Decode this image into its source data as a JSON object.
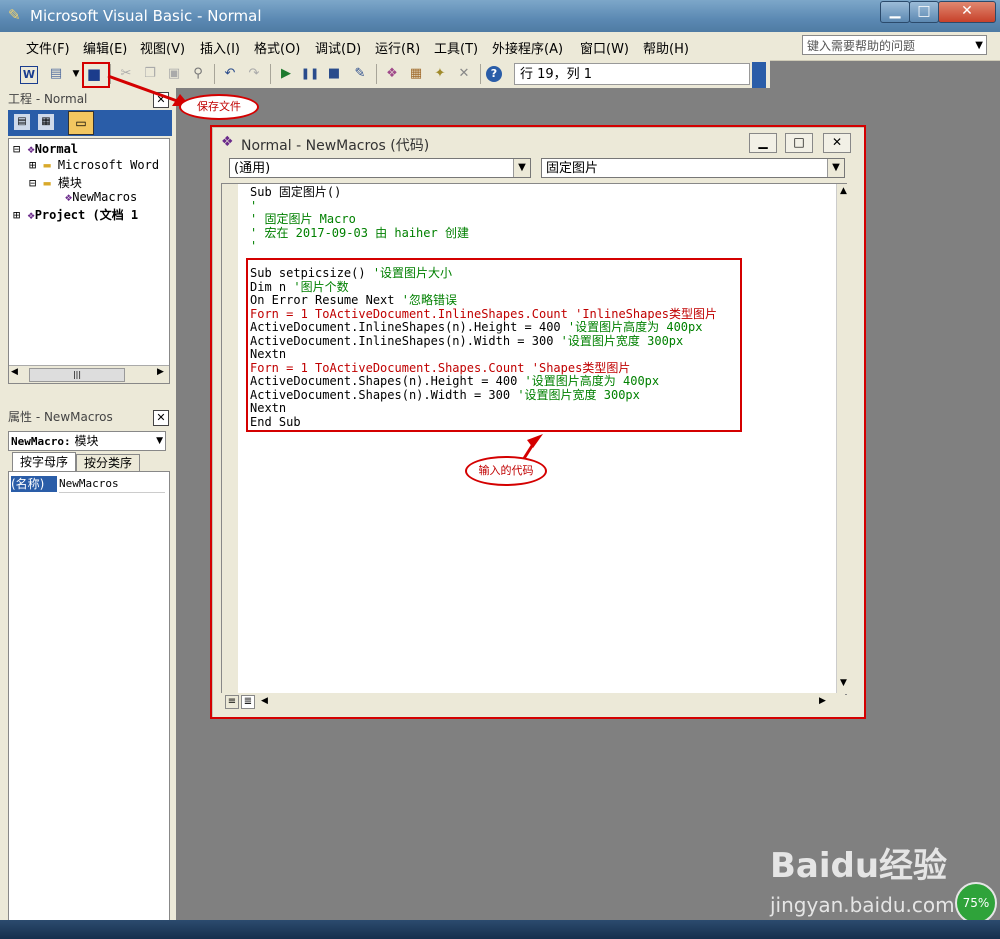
{
  "window": {
    "title": "Microsoft Visual Basic - Normal",
    "minimize": "▁",
    "restore": "□",
    "close": "✕"
  },
  "menu": [
    "文件(F)",
    "编辑(E)",
    "视图(V)",
    "插入(I)",
    "格式(O)",
    "调试(D)",
    "运行(R)",
    "工具(T)",
    "外接程序(A)",
    "窗口(W)",
    "帮助(H)"
  ],
  "help_search": {
    "placeholder": "键入需要帮助的问题"
  },
  "toolbar": {
    "position": "行 19，列 1"
  },
  "project_panel": {
    "title": "工程 - Normal",
    "tree": [
      "Normal",
      "Microsoft Word",
      "模块",
      "NewMacros",
      "Project (文档 1"
    ]
  },
  "properties_panel": {
    "title": "属性 - NewMacros",
    "object_name": "NewMacro:",
    "object_type": "模块",
    "tabs": [
      "按字母序",
      "按分类序"
    ],
    "row_key": "(名称)",
    "row_value": "NewMacros"
  },
  "code_window": {
    "title": "Normal - NewMacros (代码)",
    "object_combo": "(通用)",
    "proc_combo": "固定图片",
    "lines": [
      {
        "t": "Sub 固定图片()",
        "c": "k"
      },
      {
        "t": "'",
        "c": "g"
      },
      {
        "t": "' 固定图片 Macro",
        "c": "g"
      },
      {
        "t": "' 宏在 2017-09-03 由 haiher 创建",
        "c": "g"
      },
      {
        "t": "'",
        "c": "g"
      },
      {
        "t": "",
        "c": "k"
      },
      {
        "t": "Sub setpicsize() '设置图片大小",
        "c": "k"
      },
      {
        "t": "Dim n '图片个数",
        "c": "k"
      },
      {
        "t": "On Error Resume Next '忽略错误",
        "c": "k"
      },
      {
        "t": "Forn = 1 ToActiveDocument.InlineShapes.Count 'InlineShapes类型图片",
        "c": "r"
      },
      {
        "t": "ActiveDocument.InlineShapes(n).Height = 400 '设置图片高度为 400px",
        "c": "k"
      },
      {
        "t": "ActiveDocument.InlineShapes(n).Width = 300 '设置图片宽度 300px",
        "c": "k"
      },
      {
        "t": "Nextn",
        "c": "k"
      },
      {
        "t": "Forn = 1 ToActiveDocument.Shapes.Count 'Shapes类型图片",
        "c": "r"
      },
      {
        "t": "ActiveDocument.Shapes(n).Height = 400 '设置图片高度为 400px",
        "c": "k"
      },
      {
        "t": "ActiveDocument.Shapes(n).Width = 300 '设置图片宽度 300px",
        "c": "k"
      },
      {
        "t": "Nextn",
        "c": "k"
      },
      {
        "t": "End Sub",
        "c": "k"
      }
    ]
  },
  "annotations": {
    "save": "保存文件",
    "code": "输入的代码"
  },
  "watermark": {
    "logo": "Baidu经验",
    "url": "jingyan.baidu.com"
  },
  "badge": "75%",
  "colors": {
    "accent_red": "#d40000",
    "comment_green": "#008000",
    "error_red": "#c00000"
  }
}
